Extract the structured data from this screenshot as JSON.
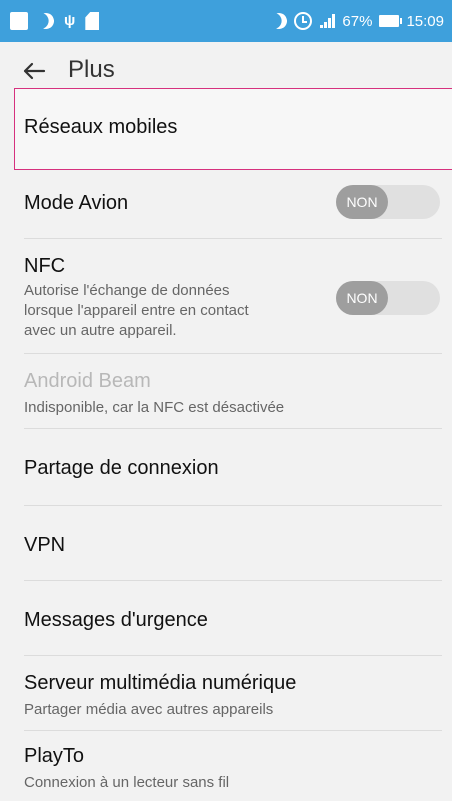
{
  "statusbar": {
    "icons_left": [
      "square-notification-icon",
      "moon-icon",
      "usb-icon",
      "sd-card-icon"
    ],
    "icons_right": [
      "moon-icon",
      "alarm-icon",
      "signal-icon",
      "battery-icon"
    ],
    "battery_percent": "67%",
    "time": "15:09",
    "usb_glyph": "ψ"
  },
  "appbar": {
    "title": "Plus"
  },
  "rows": {
    "mobile_networks": {
      "title": "Réseaux mobiles"
    },
    "airplane_mode": {
      "title": "Mode Avion",
      "toggle": "NON"
    },
    "nfc": {
      "title": "NFC",
      "subtitle_line1": "Autorise l'échange de données",
      "subtitle_line2": "lorsque l'appareil entre en contact",
      "subtitle_line3": "avec un autre appareil.",
      "toggle": "NON"
    },
    "android_beam": {
      "title": "Android Beam",
      "subtitle": "Indisponible, car la NFC est désactivée"
    },
    "tethering": {
      "title": "Partage de connexion"
    },
    "vpn": {
      "title": "VPN"
    },
    "emergency": {
      "title": "Messages d'urgence"
    },
    "media_server": {
      "title": "Serveur multimédia numérique",
      "subtitle": "Partager média avec autres appareils"
    },
    "playto": {
      "title": "PlayTo",
      "subtitle": "Connexion à un lecteur sans fil"
    }
  },
  "colors": {
    "statusbar": "#3ea0dc",
    "background": "#f2f2f2",
    "highlight_border": "#d6317e",
    "toggle_off_track": "#e0e0e0",
    "toggle_off_knob": "#9e9e9e"
  }
}
